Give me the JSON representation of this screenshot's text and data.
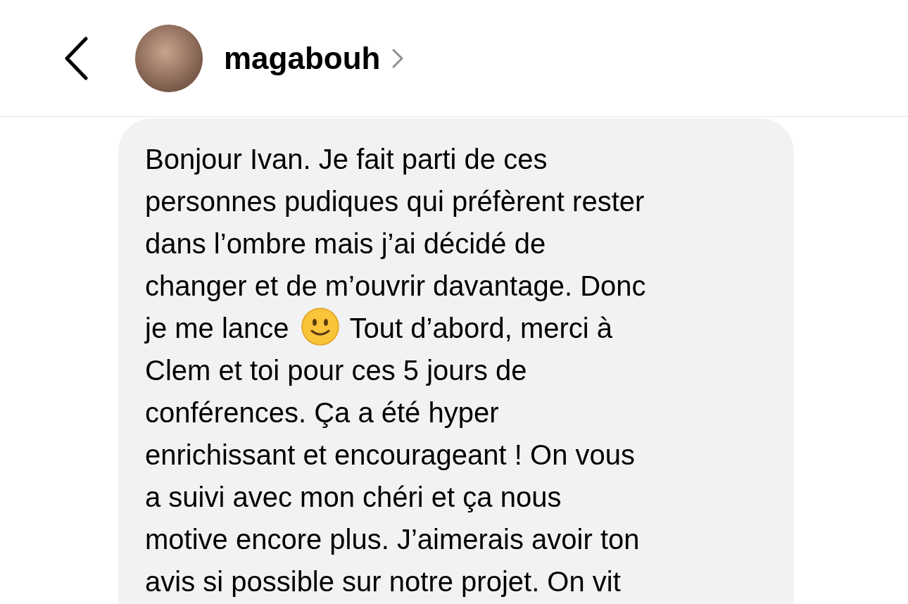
{
  "header": {
    "username": "magabouh"
  },
  "message": {
    "lines": [
      {
        "text": "Bonjour Ivan. Je fait parti de ces"
      },
      {
        "text": "personnes pudiques qui préfèrent rester"
      },
      {
        "text": "dans l’ombre mais j’ai décidé de"
      },
      {
        "text": "changer et de m’ouvrir davantage. Donc"
      },
      {
        "text": "je me lance",
        "emoji": true,
        "after": "Tout d’abord, merci à"
      },
      {
        "text": "Clem et toi pour ces 5 jours de"
      },
      {
        "text": "conférences. Ça a été hyper"
      },
      {
        "text": "enrichissant et encourageant ! On vous"
      },
      {
        "text": "a suivi avec mon chéri et ça nous"
      },
      {
        "text": "motive encore plus. J’aimerais avoir ton"
      },
      {
        "text": "avis si possible sur notre projet. On vit"
      }
    ]
  }
}
